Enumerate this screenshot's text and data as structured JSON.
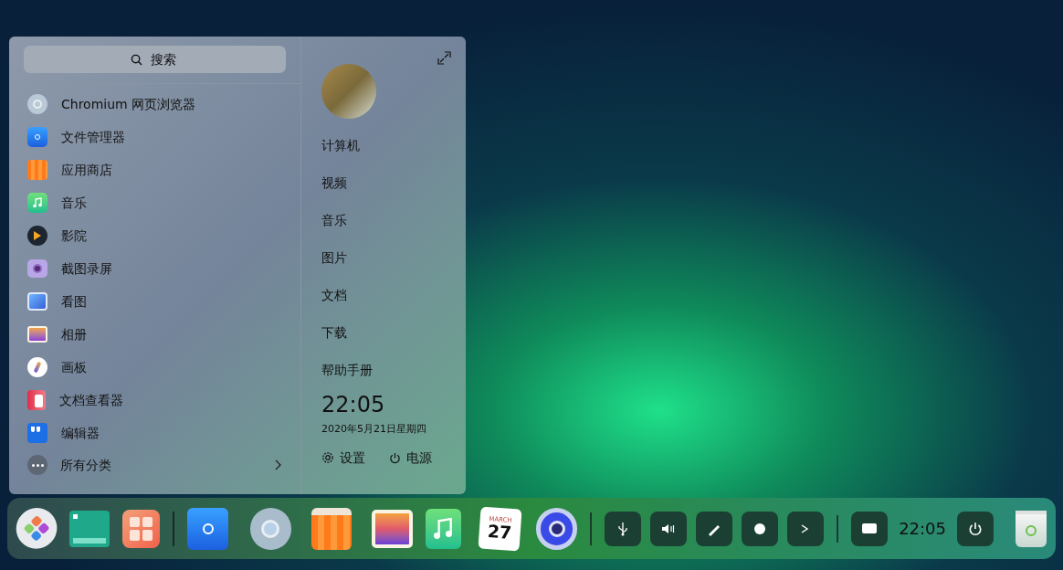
{
  "launcher": {
    "search": {
      "placeholder": "搜索"
    },
    "apps": [
      {
        "name": "Chromium 网页浏览器"
      },
      {
        "name": "文件管理器"
      },
      {
        "name": "应用商店"
      },
      {
        "name": "音乐"
      },
      {
        "name": "影院"
      },
      {
        "name": "截图录屏"
      },
      {
        "name": "看图"
      },
      {
        "name": "相册"
      },
      {
        "name": "画板"
      },
      {
        "name": "文档查看器"
      },
      {
        "name": "编辑器"
      }
    ],
    "all_categories": "所有分类",
    "places": [
      "计算机",
      "视频",
      "音乐",
      "图片",
      "文档",
      "下载",
      "帮助手册"
    ],
    "time": "22:05",
    "date": "2020年5月21日星期四",
    "settings": "设置",
    "power": "电源"
  },
  "dock": {
    "calendar_month": "MARCH",
    "calendar_day": "27",
    "tray_time": "22:05"
  }
}
